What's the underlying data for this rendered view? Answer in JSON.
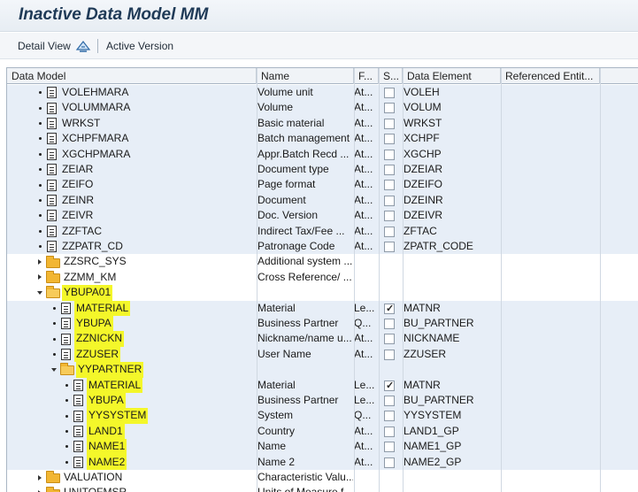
{
  "window": {
    "title": "Inactive Data Model MM"
  },
  "toolbar": {
    "detail_view": "Detail View",
    "active_version": "Active Version"
  },
  "columns": [
    "Data Model",
    "Name",
    "F...",
    "S...",
    "Data Element",
    "Referenced Entit..."
  ],
  "rows": [
    {
      "type": "leaf",
      "level": 1,
      "label": "VOLEHMARA",
      "name": "Volume unit",
      "f": "At...",
      "s": false,
      "de": "VOLEH",
      "hl": false
    },
    {
      "type": "leaf",
      "level": 1,
      "label": "VOLUMMARA",
      "name": "Volume",
      "f": "At...",
      "s": false,
      "de": "VOLUM",
      "hl": false
    },
    {
      "type": "leaf",
      "level": 1,
      "label": "WRKST",
      "name": "Basic material",
      "f": "At...",
      "s": false,
      "de": "WRKST",
      "hl": false
    },
    {
      "type": "leaf",
      "level": 1,
      "label": "XCHPFMARA",
      "name": "Batch management",
      "f": "At...",
      "s": false,
      "de": "XCHPF",
      "hl": false
    },
    {
      "type": "leaf",
      "level": 1,
      "label": "XGCHPMARA",
      "name": "Appr.Batch Recd ...",
      "f": "At...",
      "s": false,
      "de": "XGCHP",
      "hl": false
    },
    {
      "type": "leaf",
      "level": 1,
      "label": "ZEIAR",
      "name": "Document type",
      "f": "At...",
      "s": false,
      "de": "DZEIAR",
      "hl": false
    },
    {
      "type": "leaf",
      "level": 1,
      "label": "ZEIFO",
      "name": "Page format",
      "f": "At...",
      "s": false,
      "de": "DZEIFO",
      "hl": false
    },
    {
      "type": "leaf",
      "level": 1,
      "label": "ZEINR",
      "name": "Document",
      "f": "At...",
      "s": false,
      "de": "DZEINR",
      "hl": false
    },
    {
      "type": "leaf",
      "level": 1,
      "label": "ZEIVR",
      "name": "Doc. Version",
      "f": "At...",
      "s": false,
      "de": "DZEIVR",
      "hl": false
    },
    {
      "type": "leaf",
      "level": 1,
      "label": "ZZFTAC",
      "name": "Indirect Tax/Fee ...",
      "f": "At...",
      "s": false,
      "de": "ZFTAC",
      "hl": false
    },
    {
      "type": "leaf",
      "level": 1,
      "label": "ZZPATR_CD",
      "name": "Patronage Code",
      "f": "At...",
      "s": false,
      "de": "ZPATR_CODE",
      "hl": false
    },
    {
      "type": "folder",
      "level": 1,
      "open": false,
      "label": "ZZSRC_SYS",
      "name": "Additional system ...",
      "f": "",
      "s": null,
      "de": "",
      "hl": false
    },
    {
      "type": "folder",
      "level": 1,
      "open": false,
      "label": "ZZMM_KM",
      "name": "Cross Reference/ ...",
      "f": "",
      "s": null,
      "de": "",
      "hl": false
    },
    {
      "type": "folder",
      "level": 1,
      "open": true,
      "label": "YBUPA01",
      "name": "",
      "f": "",
      "s": null,
      "de": "",
      "hl": true
    },
    {
      "type": "leaf",
      "level": 2,
      "label": "MATERIAL",
      "name": "Material",
      "f": "Le...",
      "s": true,
      "de": "MATNR",
      "hl": true
    },
    {
      "type": "leaf",
      "level": 2,
      "label": "YBUPA",
      "name": "Business Partner",
      "f": "Q...",
      "s": false,
      "de": "BU_PARTNER",
      "hl": true
    },
    {
      "type": "leaf",
      "level": 2,
      "label": "ZZNICKN",
      "name": "Nickname/name u...",
      "f": "At...",
      "s": false,
      "de": "NICKNAME",
      "hl": true
    },
    {
      "type": "leaf",
      "level": 2,
      "label": "ZZUSER",
      "name": "User Name",
      "f": "At...",
      "s": false,
      "de": "ZZUSER",
      "hl": true
    },
    {
      "type": "folder",
      "level": 2,
      "open": true,
      "label": "YYPARTNER",
      "name": "",
      "f": "",
      "s": null,
      "de": "",
      "hl": true
    },
    {
      "type": "leaf",
      "level": 3,
      "label": "MATERIAL",
      "name": "Material",
      "f": "Le...",
      "s": true,
      "de": "MATNR",
      "hl": true
    },
    {
      "type": "leaf",
      "level": 3,
      "label": "YBUPA",
      "name": "Business Partner",
      "f": "Le...",
      "s": false,
      "de": "BU_PARTNER",
      "hl": true
    },
    {
      "type": "leaf",
      "level": 3,
      "label": "YYSYSTEM",
      "name": "System",
      "f": "Q...",
      "s": false,
      "de": "YYSYSTEM",
      "hl": true
    },
    {
      "type": "leaf",
      "level": 3,
      "label": "LAND1",
      "name": "Country",
      "f": "At...",
      "s": false,
      "de": "LAND1_GP",
      "hl": true
    },
    {
      "type": "leaf",
      "level": 3,
      "label": "NAME1",
      "name": "Name",
      "f": "At...",
      "s": false,
      "de": "NAME1_GP",
      "hl": true
    },
    {
      "type": "leaf",
      "level": 3,
      "label": "NAME2",
      "name": "Name 2",
      "f": "At...",
      "s": false,
      "de": "NAME2_GP",
      "hl": true
    },
    {
      "type": "folder",
      "level": 1,
      "open": false,
      "label": "VALUATION",
      "name": "Characteristic Valu...",
      "f": "",
      "s": null,
      "de": "",
      "hl": false
    },
    {
      "type": "folder",
      "level": 1,
      "open": false,
      "label": "UNITOFMSR",
      "name": "Units of Measure f...",
      "f": "",
      "s": null,
      "de": "",
      "hl": false
    }
  ],
  "colors": {
    "highlight": "#f4f72a",
    "band": "#e7eef7",
    "title": "#1f3a57"
  }
}
